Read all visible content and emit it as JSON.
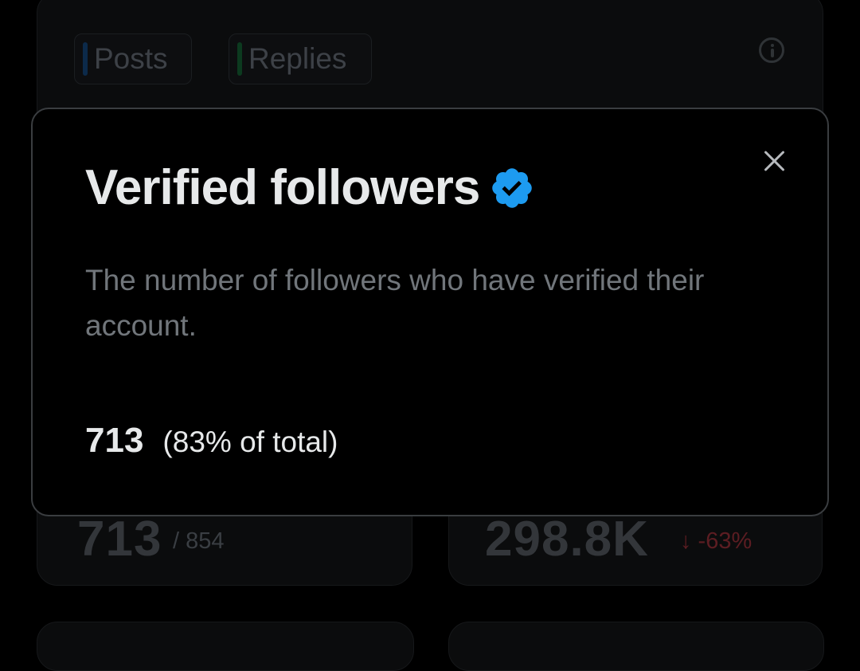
{
  "background": {
    "chips": [
      {
        "label": "Posts",
        "color": "#0c2a4a"
      },
      {
        "label": "Replies",
        "color": "#0c3a1f"
      }
    ],
    "stats": [
      {
        "value": "713",
        "secondary": "/ 854"
      },
      {
        "value": "298.8K",
        "delta": "↓ -63%"
      }
    ]
  },
  "modal": {
    "title": "Verified followers",
    "description": "The number of followers who have verified their account.",
    "metric_value": "713",
    "metric_percent": "(83% of total)",
    "verified_color": "#1d9bf0"
  },
  "icons": {
    "close": "close-icon",
    "info": "info-icon",
    "verified": "verified-badge-icon"
  }
}
